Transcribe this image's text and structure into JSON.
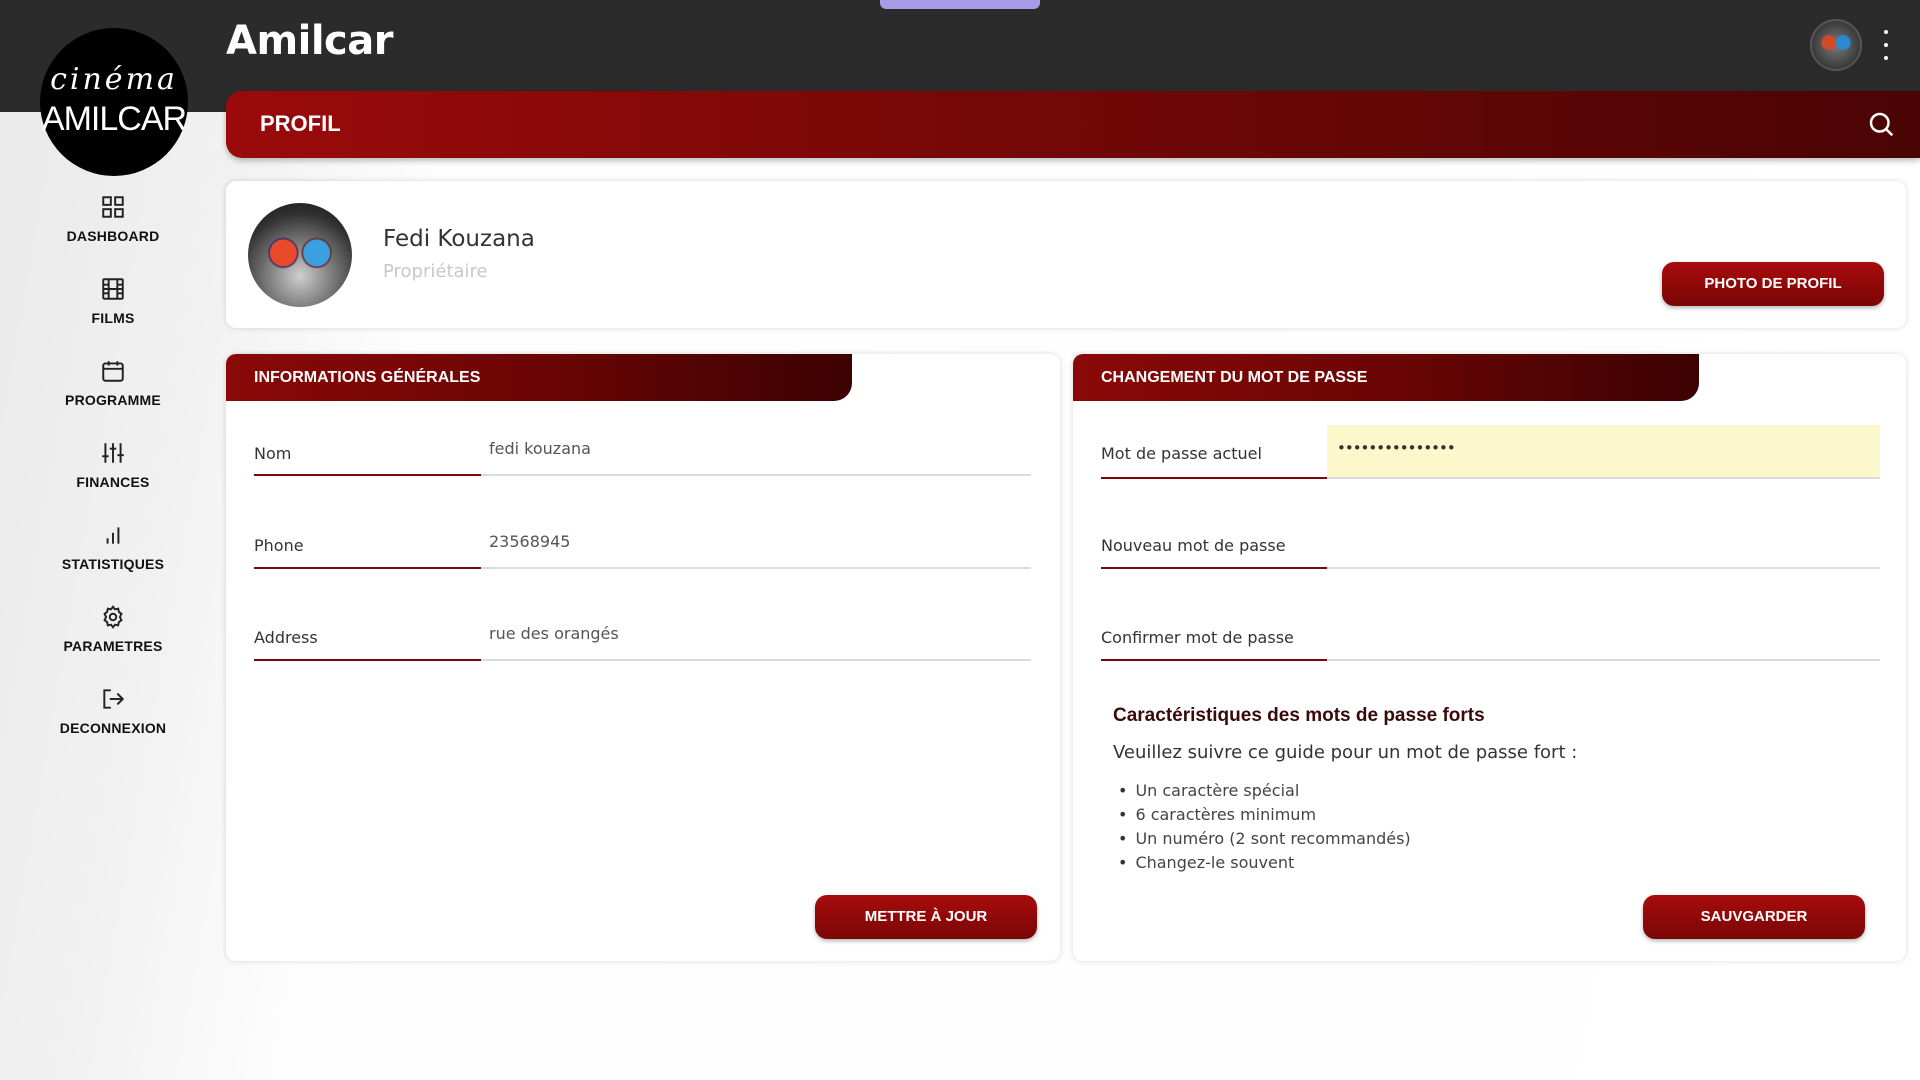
{
  "topbar": {
    "app_title": "Amilcar",
    "avatar_icon": "user-avatar",
    "menu_icon": "kebab-menu-icon"
  },
  "logo": {
    "line1": "cinéma",
    "line2": "AMILCAR"
  },
  "sidebar": {
    "items": [
      {
        "label": "DASHBOARD",
        "icon": "dashboard-grid-icon"
      },
      {
        "label": "FILMS",
        "icon": "film-icon"
      },
      {
        "label": "PROGRAMME",
        "icon": "calendar-icon"
      },
      {
        "label": "FINANCES",
        "icon": "sliders-icon"
      },
      {
        "label": "STATISTIQUES",
        "icon": "bar-chart-icon"
      },
      {
        "label": "PARAMETRES",
        "icon": "gear-icon"
      },
      {
        "label": "DECONNEXION",
        "icon": "logout-icon"
      }
    ]
  },
  "header": {
    "title": "PROFIL",
    "search_icon": "search-icon"
  },
  "profile": {
    "name": "Fedi Kouzana",
    "role": "Propriétaire",
    "photo_button": "PHOTO DE PROFIL"
  },
  "general_info": {
    "section_title": "INFORMATIONS GÉNÉRALES",
    "fields": [
      {
        "label": "Nom",
        "value": "fedi kouzana"
      },
      {
        "label": "Phone",
        "value": "23568945"
      },
      {
        "label": "Address",
        "value": "rue des orangés"
      }
    ],
    "update_button": "METTRE À JOUR"
  },
  "password": {
    "section_title": "CHANGEMENT DU MOT DE PASSE",
    "current_label": "Mot de passe actuel",
    "current_value": "•••••••••••••••",
    "new_label": "Nouveau mot de passe",
    "confirm_label": "Confirmer mot de passe",
    "guide_title": "Caractéristiques des mots de passe forts",
    "guide_intro": "Veuillez suivre ce guide pour un mot de passe fort :",
    "guide_items": [
      "Un caractère spécial",
      "6 caractères minimum",
      "Un numéro (2 sont recommandés)",
      "Changez-le souvent"
    ],
    "save_button": "SAUVGARDER"
  },
  "colors": {
    "accent": "#8a0808",
    "accent_dark": "#4a0404",
    "topbar": "#2b2b2b",
    "autofill": "#fdf8cc"
  }
}
